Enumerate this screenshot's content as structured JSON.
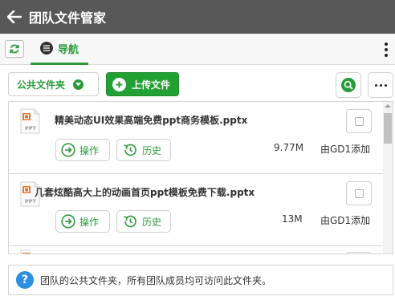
{
  "window": {
    "title": "团队文件管家"
  },
  "tabs": [
    {
      "label": "导航"
    }
  ],
  "toolbar": {
    "folder_label": "公共文件夹",
    "upload_label": "上传文件"
  },
  "files": [
    {
      "name": "精美动态UI效果高端免费ppt商务模板.pptx",
      "size": "9.77M",
      "owner": "由GD1添加",
      "icon_text": "PPT",
      "actions": [
        "操作",
        "历史"
      ]
    },
    {
      "name": "几套炫酷高大上的动画首页ppt模板免费下载.pptx",
      "size": "13M",
      "owner": "由GD1添加",
      "icon_text": "PPT",
      "actions": [
        "操作",
        "历史"
      ]
    }
  ],
  "info": {
    "text": "团队的公共文件夹，所有团队成员均可访问此文件夹。"
  },
  "colors": {
    "accent": "#2b9a3c",
    "title_bar": "#585858",
    "ppt_orange": "#e8782c",
    "help_blue": "#2c8fe0"
  },
  "icons": [
    "back-arrow-icon",
    "refresh-icon",
    "menu-icon",
    "chevron-down-icon",
    "plus-icon",
    "search-icon",
    "more-icon",
    "ppt-file-icon",
    "arrow-circle-icon",
    "history-icon",
    "help-icon"
  ]
}
